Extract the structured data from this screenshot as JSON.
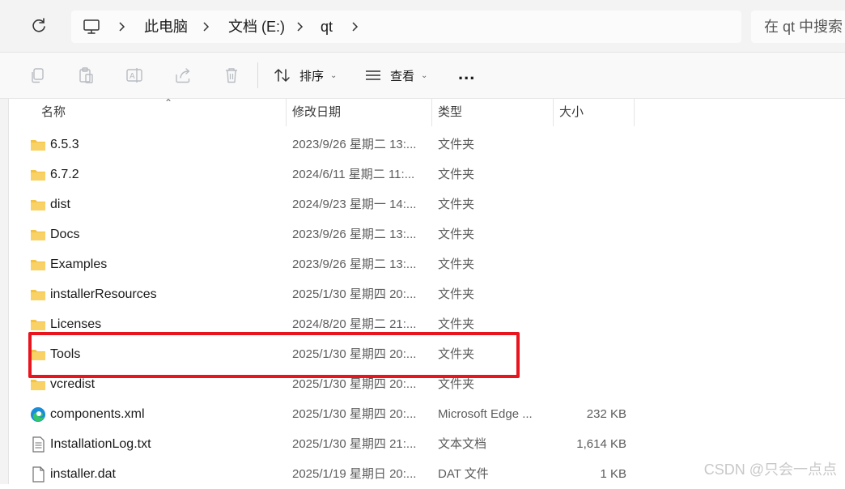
{
  "address": {
    "crumbs": [
      "此电脑",
      "文档 (E:)",
      "qt"
    ],
    "search_placeholder": "在 qt 中搜索"
  },
  "toolbar": {
    "sort_label": "排序",
    "view_label": "查看",
    "more_label": "..."
  },
  "columns": {
    "name": "名称",
    "modified": "修改日期",
    "type": "类型",
    "size": "大小"
  },
  "files": [
    {
      "name": "6.5.3",
      "date": "2023/9/26 星期二 13:...",
      "type": "文件夹",
      "size": "",
      "icon": "folder-icon"
    },
    {
      "name": "6.7.2",
      "date": "2024/6/11 星期二 11:...",
      "type": "文件夹",
      "size": "",
      "icon": "folder-icon"
    },
    {
      "name": "dist",
      "date": "2024/9/23 星期一 14:...",
      "type": "文件夹",
      "size": "",
      "icon": "folder-icon"
    },
    {
      "name": "Docs",
      "date": "2023/9/26 星期二 13:...",
      "type": "文件夹",
      "size": "",
      "icon": "folder-icon"
    },
    {
      "name": "Examples",
      "date": "2023/9/26 星期二 13:...",
      "type": "文件夹",
      "size": "",
      "icon": "folder-icon"
    },
    {
      "name": "installerResources",
      "date": "2025/1/30 星期四 20:...",
      "type": "文件夹",
      "size": "",
      "icon": "folder-icon"
    },
    {
      "name": "Licenses",
      "date": "2024/8/20 星期二 21:...",
      "type": "文件夹",
      "size": "",
      "icon": "folder-icon"
    },
    {
      "name": "Tools",
      "date": "2025/1/30 星期四 20:...",
      "type": "文件夹",
      "size": "",
      "icon": "folder-icon"
    },
    {
      "name": "vcredist",
      "date": "2025/1/30 星期四 20:...",
      "type": "文件夹",
      "size": "",
      "icon": "folder-icon"
    },
    {
      "name": "components.xml",
      "date": "2025/1/30 星期四 20:...",
      "type": "Microsoft Edge ...",
      "size": "232 KB",
      "icon": "edge-icon"
    },
    {
      "name": "InstallationLog.txt",
      "date": "2025/1/30 星期四 21:...",
      "type": "文本文档",
      "size": "1,614 KB",
      "icon": "text-file-icon"
    },
    {
      "name": "installer.dat",
      "date": "2025/1/19 星期日 20:...",
      "type": "DAT 文件",
      "size": "1 KB",
      "icon": "file-icon"
    }
  ],
  "highlighted_row": "Tools",
  "watermark": "CSDN @只会一点点",
  "colors": {
    "folder": "#f5c242",
    "highlight": "#e8141e",
    "edge": "#1a8cd8"
  }
}
